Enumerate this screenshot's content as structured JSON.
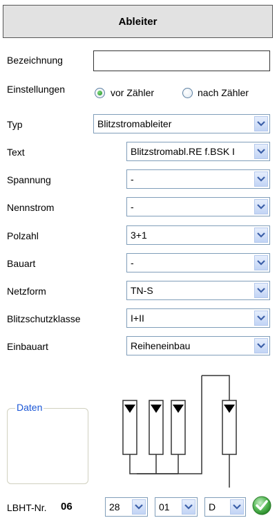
{
  "header": {
    "title": "Ableiter"
  },
  "fields": {
    "bezeichnung": {
      "label": "Bezeichnung",
      "value": ""
    },
    "einstellungen": {
      "label": "Einstellungen",
      "options": [
        {
          "label": "vor Zähler",
          "selected": true
        },
        {
          "label": "nach Zähler",
          "selected": false
        }
      ]
    },
    "typ": {
      "label": "Typ",
      "value": "Blitzstromableiter"
    },
    "text": {
      "label": "Text",
      "value": "Blitzstromabl.RE f.BSK I"
    },
    "spannung": {
      "label": "Spannung",
      "value": "-"
    },
    "nennstrom": {
      "label": "Nennstrom",
      "value": "-"
    },
    "polzahl": {
      "label": "Polzahl",
      "value": "3+1"
    },
    "bauart": {
      "label": "Bauart",
      "value": "-"
    },
    "netzform": {
      "label": "Netzform",
      "value": "TN-S"
    },
    "blitzschutzklasse": {
      "label": "Blitzschutzklasse",
      "value": "I+II"
    },
    "einbauart": {
      "label": "Einbauart",
      "value": "Reiheneinbau"
    }
  },
  "daten": {
    "legend": "Daten"
  },
  "lbht": {
    "label": "LBHT-Nr.",
    "number": "06",
    "select1": "28",
    "select2": "01",
    "select3": "D"
  },
  "colors": {
    "header_bg": "#e2e2e2",
    "combo_border": "#7f9db9",
    "legend_text": "#1a56d6",
    "confirm_green": "#2e9e2e"
  },
  "icons": {
    "dropdown": "chevron-down-icon",
    "confirm": "checkmark-icon"
  }
}
